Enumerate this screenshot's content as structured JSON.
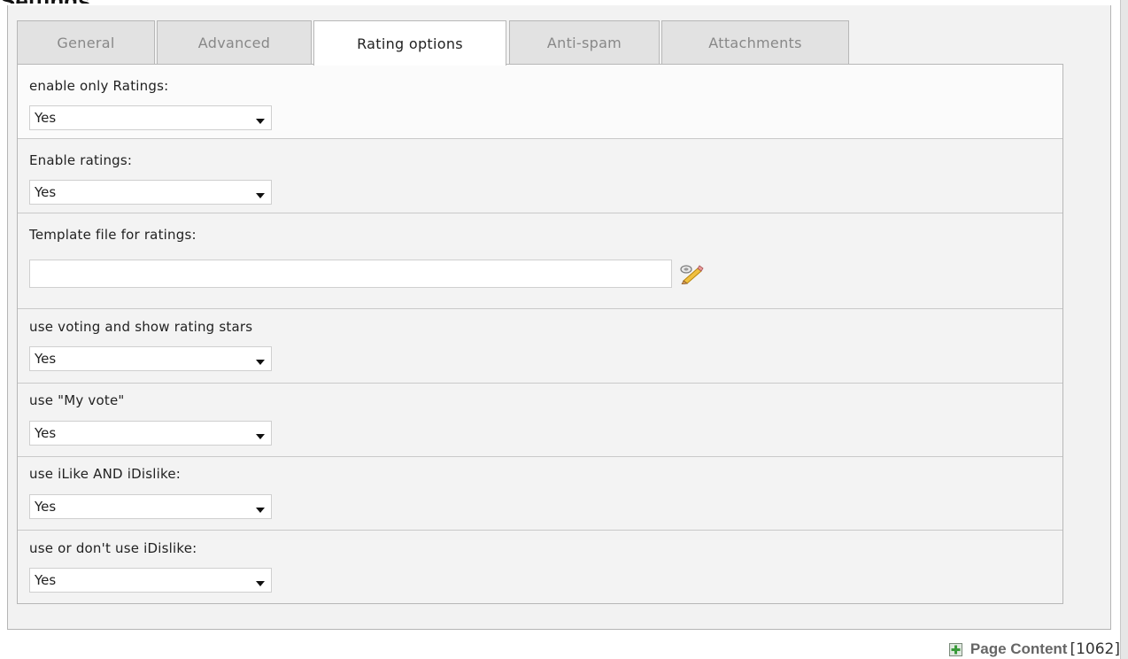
{
  "header": {
    "partial_title": "Page Content"
  },
  "tabs": [
    {
      "label": "General"
    },
    {
      "label": "Advanced"
    },
    {
      "label": "Rating options"
    },
    {
      "label": "Anti-spam"
    },
    {
      "label": "Attachments"
    }
  ],
  "active_tab": "Rating options",
  "fields": [
    {
      "label": "enable only Ratings:",
      "value": "Yes"
    },
    {
      "label": "Enable ratings:",
      "value": "Yes"
    },
    {
      "label": "Template file for ratings:",
      "value": ""
    },
    {
      "label": "use voting and show rating stars",
      "value": "Yes"
    },
    {
      "label": "use \"My vote\"",
      "value": "Yes"
    },
    {
      "label": "use iLike AND iDislike:",
      "value": "Yes"
    },
    {
      "label": "use or don't use iDislike:",
      "value": "Yes"
    }
  ],
  "icons": {
    "wizard": "pencil-wizard-icon",
    "footer": "add-content-icon"
  },
  "footer": {
    "label": "Page Content",
    "id": "[1062]"
  },
  "colors": {
    "panel_bg": "#f3f3f3",
    "tab_inactive": "#e2e2e2",
    "tab_active": "#ffffff",
    "footer_icon": "#3a9a3a"
  }
}
